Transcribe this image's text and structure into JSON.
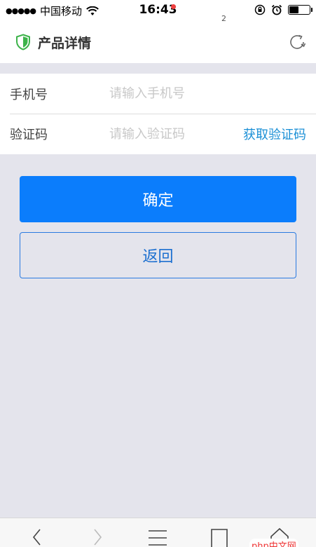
{
  "status_bar": {
    "signal": "●●●●●",
    "carrier": "中国移动",
    "time": "16:43"
  },
  "header": {
    "title": "产品详情"
  },
  "form": {
    "phone_label": "手机号",
    "phone_placeholder": "请输入手机号",
    "phone_value": "",
    "code_label": "验证码",
    "code_placeholder": "请输入验证码",
    "code_value": "",
    "get_code_label": "获取验证码"
  },
  "actions": {
    "confirm_label": "确定",
    "back_label": "返回"
  },
  "toolbar": {
    "tabs_count": "2"
  },
  "watermark": "php中文网",
  "colors": {
    "primary": "#0b7dfc",
    "link": "#1a8fd6",
    "background": "#e4e4ec",
    "badge": "#f04040"
  }
}
